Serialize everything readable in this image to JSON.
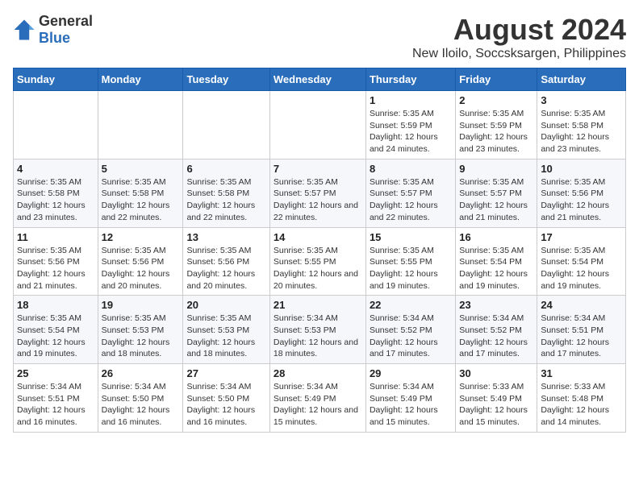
{
  "header": {
    "logo_general": "General",
    "logo_blue": "Blue",
    "main_title": "August 2024",
    "subtitle": "New Iloilo, Soccsksargen, Philippines"
  },
  "columns": [
    "Sunday",
    "Monday",
    "Tuesday",
    "Wednesday",
    "Thursday",
    "Friday",
    "Saturday"
  ],
  "weeks": [
    [
      {
        "day": "",
        "info": ""
      },
      {
        "day": "",
        "info": ""
      },
      {
        "day": "",
        "info": ""
      },
      {
        "day": "",
        "info": ""
      },
      {
        "day": "1",
        "info": "Sunrise: 5:35 AM\nSunset: 5:59 PM\nDaylight: 12 hours and 24 minutes."
      },
      {
        "day": "2",
        "info": "Sunrise: 5:35 AM\nSunset: 5:59 PM\nDaylight: 12 hours and 23 minutes."
      },
      {
        "day": "3",
        "info": "Sunrise: 5:35 AM\nSunset: 5:58 PM\nDaylight: 12 hours and 23 minutes."
      }
    ],
    [
      {
        "day": "4",
        "info": "Sunrise: 5:35 AM\nSunset: 5:58 PM\nDaylight: 12 hours and 23 minutes."
      },
      {
        "day": "5",
        "info": "Sunrise: 5:35 AM\nSunset: 5:58 PM\nDaylight: 12 hours and 22 minutes."
      },
      {
        "day": "6",
        "info": "Sunrise: 5:35 AM\nSunset: 5:58 PM\nDaylight: 12 hours and 22 minutes."
      },
      {
        "day": "7",
        "info": "Sunrise: 5:35 AM\nSunset: 5:57 PM\nDaylight: 12 hours and 22 minutes."
      },
      {
        "day": "8",
        "info": "Sunrise: 5:35 AM\nSunset: 5:57 PM\nDaylight: 12 hours and 22 minutes."
      },
      {
        "day": "9",
        "info": "Sunrise: 5:35 AM\nSunset: 5:57 PM\nDaylight: 12 hours and 21 minutes."
      },
      {
        "day": "10",
        "info": "Sunrise: 5:35 AM\nSunset: 5:56 PM\nDaylight: 12 hours and 21 minutes."
      }
    ],
    [
      {
        "day": "11",
        "info": "Sunrise: 5:35 AM\nSunset: 5:56 PM\nDaylight: 12 hours and 21 minutes."
      },
      {
        "day": "12",
        "info": "Sunrise: 5:35 AM\nSunset: 5:56 PM\nDaylight: 12 hours and 20 minutes."
      },
      {
        "day": "13",
        "info": "Sunrise: 5:35 AM\nSunset: 5:56 PM\nDaylight: 12 hours and 20 minutes."
      },
      {
        "day": "14",
        "info": "Sunrise: 5:35 AM\nSunset: 5:55 PM\nDaylight: 12 hours and 20 minutes."
      },
      {
        "day": "15",
        "info": "Sunrise: 5:35 AM\nSunset: 5:55 PM\nDaylight: 12 hours and 19 minutes."
      },
      {
        "day": "16",
        "info": "Sunrise: 5:35 AM\nSunset: 5:54 PM\nDaylight: 12 hours and 19 minutes."
      },
      {
        "day": "17",
        "info": "Sunrise: 5:35 AM\nSunset: 5:54 PM\nDaylight: 12 hours and 19 minutes."
      }
    ],
    [
      {
        "day": "18",
        "info": "Sunrise: 5:35 AM\nSunset: 5:54 PM\nDaylight: 12 hours and 19 minutes."
      },
      {
        "day": "19",
        "info": "Sunrise: 5:35 AM\nSunset: 5:53 PM\nDaylight: 12 hours and 18 minutes."
      },
      {
        "day": "20",
        "info": "Sunrise: 5:35 AM\nSunset: 5:53 PM\nDaylight: 12 hours and 18 minutes."
      },
      {
        "day": "21",
        "info": "Sunrise: 5:34 AM\nSunset: 5:53 PM\nDaylight: 12 hours and 18 minutes."
      },
      {
        "day": "22",
        "info": "Sunrise: 5:34 AM\nSunset: 5:52 PM\nDaylight: 12 hours and 17 minutes."
      },
      {
        "day": "23",
        "info": "Sunrise: 5:34 AM\nSunset: 5:52 PM\nDaylight: 12 hours and 17 minutes."
      },
      {
        "day": "24",
        "info": "Sunrise: 5:34 AM\nSunset: 5:51 PM\nDaylight: 12 hours and 17 minutes."
      }
    ],
    [
      {
        "day": "25",
        "info": "Sunrise: 5:34 AM\nSunset: 5:51 PM\nDaylight: 12 hours and 16 minutes."
      },
      {
        "day": "26",
        "info": "Sunrise: 5:34 AM\nSunset: 5:50 PM\nDaylight: 12 hours and 16 minutes."
      },
      {
        "day": "27",
        "info": "Sunrise: 5:34 AM\nSunset: 5:50 PM\nDaylight: 12 hours and 16 minutes."
      },
      {
        "day": "28",
        "info": "Sunrise: 5:34 AM\nSunset: 5:49 PM\nDaylight: 12 hours and 15 minutes."
      },
      {
        "day": "29",
        "info": "Sunrise: 5:34 AM\nSunset: 5:49 PM\nDaylight: 12 hours and 15 minutes."
      },
      {
        "day": "30",
        "info": "Sunrise: 5:33 AM\nSunset: 5:49 PM\nDaylight: 12 hours and 15 minutes."
      },
      {
        "day": "31",
        "info": "Sunrise: 5:33 AM\nSunset: 5:48 PM\nDaylight: 12 hours and 14 minutes."
      }
    ]
  ]
}
